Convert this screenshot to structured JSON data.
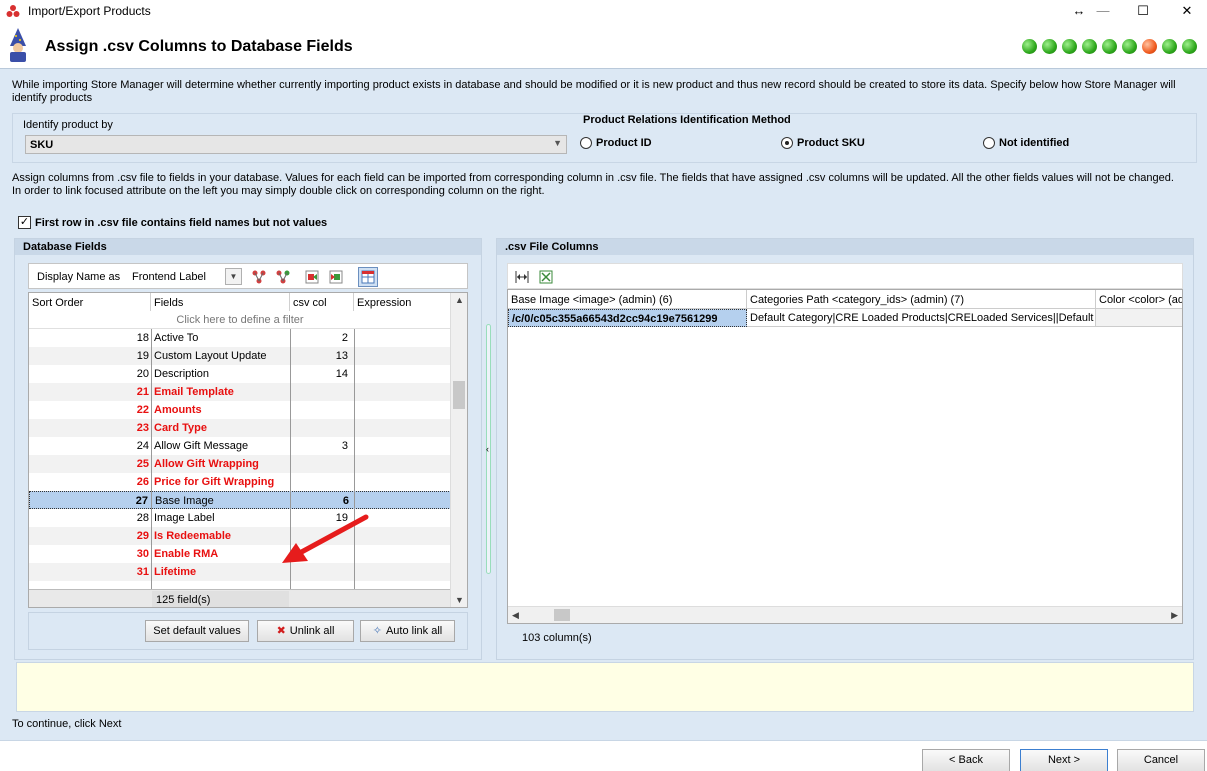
{
  "window": {
    "title": "Import/Export Products",
    "resize_glyph": "↔",
    "minimize_glyph": "—",
    "maximize_glyph": "☐",
    "close_glyph": "✕"
  },
  "header": {
    "title": "Assign .csv Columns to Database Fields",
    "steps_total": 9,
    "current_step": 7
  },
  "intro_text": "While importing Store Manager will determine whether currently importing product exists in database and should be modified or it is new product and thus new record should be created to store its data. Specify below how Store Manager will identify products",
  "identify": {
    "label": "Identify product by",
    "value": "SKU",
    "relations_title": "Product Relations Identification Method",
    "options": [
      {
        "label": "Product ID",
        "selected": false
      },
      {
        "label": "Product SKU",
        "selected": true
      },
      {
        "label": "Not identified",
        "selected": false
      }
    ]
  },
  "assign_text": "Assign columns from .csv file to fields in your database. Values for each field can be imported from corresponding column in .csv file. The fields that have assigned .csv columns will be updated. All the other fields values will not be changed. In order to link focused attribute on the left you may simply double click on corresponding column on the right.",
  "first_row_checkbox": {
    "label": "First row in .csv file contains field names but not values",
    "checked": true
  },
  "db_fields": {
    "title": "Database Fields",
    "display_name_label": "Display Name as",
    "display_name_value": "Frontend Label",
    "columns": [
      "Sort Order",
      "Fields",
      "csv col",
      "Expression"
    ],
    "filter_hint": "Click here to define a filter",
    "rows": [
      {
        "order": "18",
        "field": "Active To",
        "csv": "2",
        "required": false
      },
      {
        "order": "19",
        "field": "Custom Layout Update",
        "csv": "13",
        "required": false
      },
      {
        "order": "20",
        "field": "Description",
        "csv": "14",
        "required": false
      },
      {
        "order": "21",
        "field": "Email Template",
        "csv": "",
        "required": true
      },
      {
        "order": "22",
        "field": "Amounts",
        "csv": "",
        "required": true
      },
      {
        "order": "23",
        "field": "Card Type",
        "csv": "",
        "required": true
      },
      {
        "order": "24",
        "field": "Allow Gift Message",
        "csv": "3",
        "required": false
      },
      {
        "order": "25",
        "field": "Allow Gift Wrapping",
        "csv": "",
        "required": true
      },
      {
        "order": "26",
        "field": "Price for Gift Wrapping",
        "csv": "",
        "required": true
      },
      {
        "order": "27",
        "field": "Base Image",
        "csv": "6",
        "required": false,
        "selected": true
      },
      {
        "order": "28",
        "field": "Image Label",
        "csv": "19",
        "required": false
      },
      {
        "order": "29",
        "field": "Is Redeemable",
        "csv": "",
        "required": true
      },
      {
        "order": "30",
        "field": "Enable RMA",
        "csv": "",
        "required": true
      },
      {
        "order": "31",
        "field": "Lifetime",
        "csv": "",
        "required": true
      }
    ],
    "footer_count": "125 field(s)",
    "buttons": {
      "set_default": "Set default values",
      "unlink_all": "Unlink all",
      "auto_link_all": "Auto link all"
    }
  },
  "csv_columns": {
    "title": ".csv File Columns",
    "headers": [
      "Base Image <image> (admin) (6)",
      "Categories Path <category_ids> (admin) (7)",
      "Color <color> (admin"
    ],
    "row": [
      "/c/0/c05c355a66543d2cc94c19e7561299",
      "Default Category|CRE Loaded Products|CRELoaded Services||Default C",
      ""
    ],
    "footer_count": "103 column(s)"
  },
  "continue_text": "To continue, click Next",
  "nav": {
    "back": "< Back",
    "next": "Next >",
    "cancel": "Cancel"
  },
  "colors": {
    "required_field": "#e81010",
    "selection": "#b5d0ee",
    "panel_bg": "#dce8f4",
    "message_bg": "#ffffe5"
  }
}
